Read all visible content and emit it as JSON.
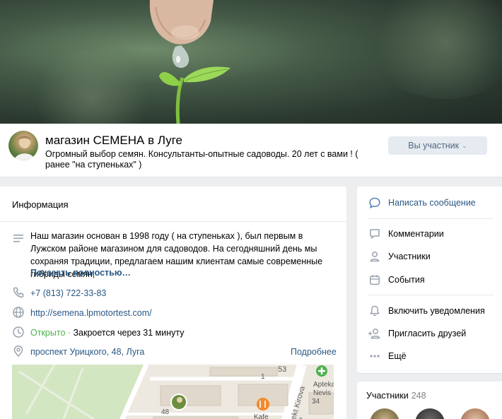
{
  "header": {
    "title": "магазин СЕМЕНА в Луге",
    "subtitle": "Огромный выбор семян. Консультанты-опытные садоводы. 20 лет с вами ! ( ранее \"на ступеньках\" )",
    "member_button": "Вы участник"
  },
  "info": {
    "section_title": "Информация",
    "description": "Наш магазин основан в 1998 году ( на ступеньках ), был первым в Лужском районе магазином для садоводов. На сегодняшний день мы сохраняя традиции, предлагаем нашим клиентам самые современные гибриды семян,",
    "show_more": "Показать полностью…",
    "phone": "+7 (813) 722-33-83",
    "website": "http://semena.lpmotortest.com/",
    "status_open": "Открыто",
    "status_sep": " · ",
    "status_closes": "Закроется через 31 минуту",
    "address": "проспект Урицкого, 48, Луга",
    "more_link": "Подробнее"
  },
  "map": {
    "labels": [
      "53",
      "1",
      "48",
      "Kafe",
      "Apteka",
      "Nevis",
      "34",
      "spekt Kirova",
      "&"
    ]
  },
  "actions": {
    "write_message": "Написать сообщение",
    "comments": "Комментарии",
    "members": "Участники",
    "events": "События",
    "notifications": "Включить уведомления",
    "invite": "Пригласить друзей",
    "more": "Ещё"
  },
  "participants": {
    "title": "Участники",
    "count": "248"
  },
  "colors": {
    "link": "#2a5885",
    "open": "#4bb34b",
    "button_bg": "#e5ebf1",
    "page_bg": "#edeef0"
  }
}
